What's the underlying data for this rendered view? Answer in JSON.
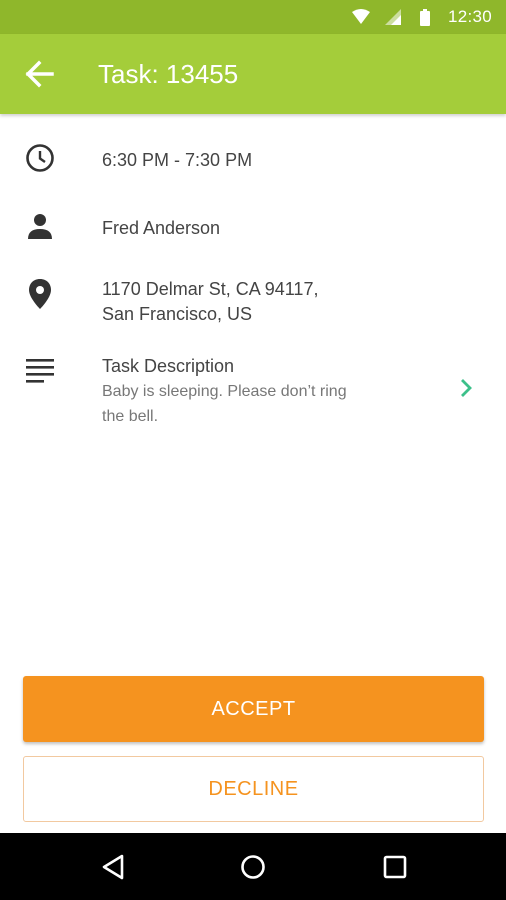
{
  "status_bar": {
    "time": "12:30",
    "icons": [
      "wifi-icon",
      "cell-signal-icon",
      "battery-icon"
    ]
  },
  "app_bar": {
    "title": "Task: 13455",
    "back_icon": "arrow-left-icon"
  },
  "details": {
    "time_range": "6:30 PM - 7:30 PM",
    "customer_name": "Fred Anderson",
    "address_line1": "1170 Delmar St, CA 94117,",
    "address_line2": "San Francisco, US",
    "description_title": "Task Description",
    "description_line1": "Baby is sleeping. Please don’t ring",
    "description_line2": "the bell."
  },
  "actions": {
    "accept_label": "ACCEPT",
    "decline_label": "DECLINE"
  },
  "colors": {
    "status_bar": "#8fb72b",
    "app_bar": "#a4cd3a",
    "accent_orange": "#f5931f",
    "chevron_green": "#3cc08a",
    "icon_dark": "#333333"
  }
}
